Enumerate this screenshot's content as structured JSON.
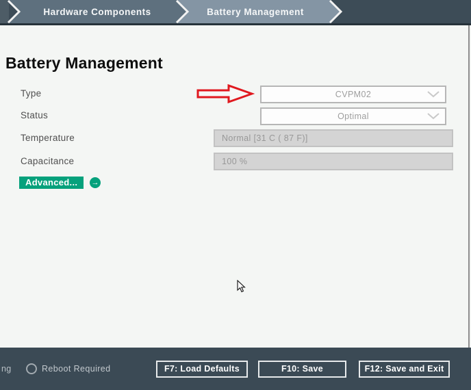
{
  "breadcrumb": {
    "items": [
      {
        "label": "Hardware Components"
      },
      {
        "label": "Battery Management"
      }
    ]
  },
  "page": {
    "title": "Battery Management"
  },
  "form": {
    "rows": [
      {
        "label": "Type",
        "value": "CVPM02",
        "control": "dropdown"
      },
      {
        "label": "Status",
        "value": "Optimal",
        "control": "dropdown"
      },
      {
        "label": "Temperature",
        "value": "Normal [31 C ( 87 F)]",
        "control": "readonly"
      },
      {
        "label": "Capacitance",
        "value": "100 %",
        "control": "readonly"
      }
    ],
    "advanced": {
      "label": "Advanced...",
      "icon_glyph": "→"
    }
  },
  "footer": {
    "truncated_text": "ng",
    "reboot_indicator_label": "Reboot Required",
    "buttons": [
      {
        "label": "F7: Load Defaults"
      },
      {
        "label": "F10: Save"
      },
      {
        "label": "F12: Save and Exit"
      }
    ]
  },
  "colors": {
    "accent_teal": "#06a17c",
    "header_bg": "#3d4c57",
    "segment_parent": "#5e707e",
    "segment_active": "#8495a4",
    "footer_bg": "#3b4a55",
    "annotation_red": "#e0191f"
  }
}
